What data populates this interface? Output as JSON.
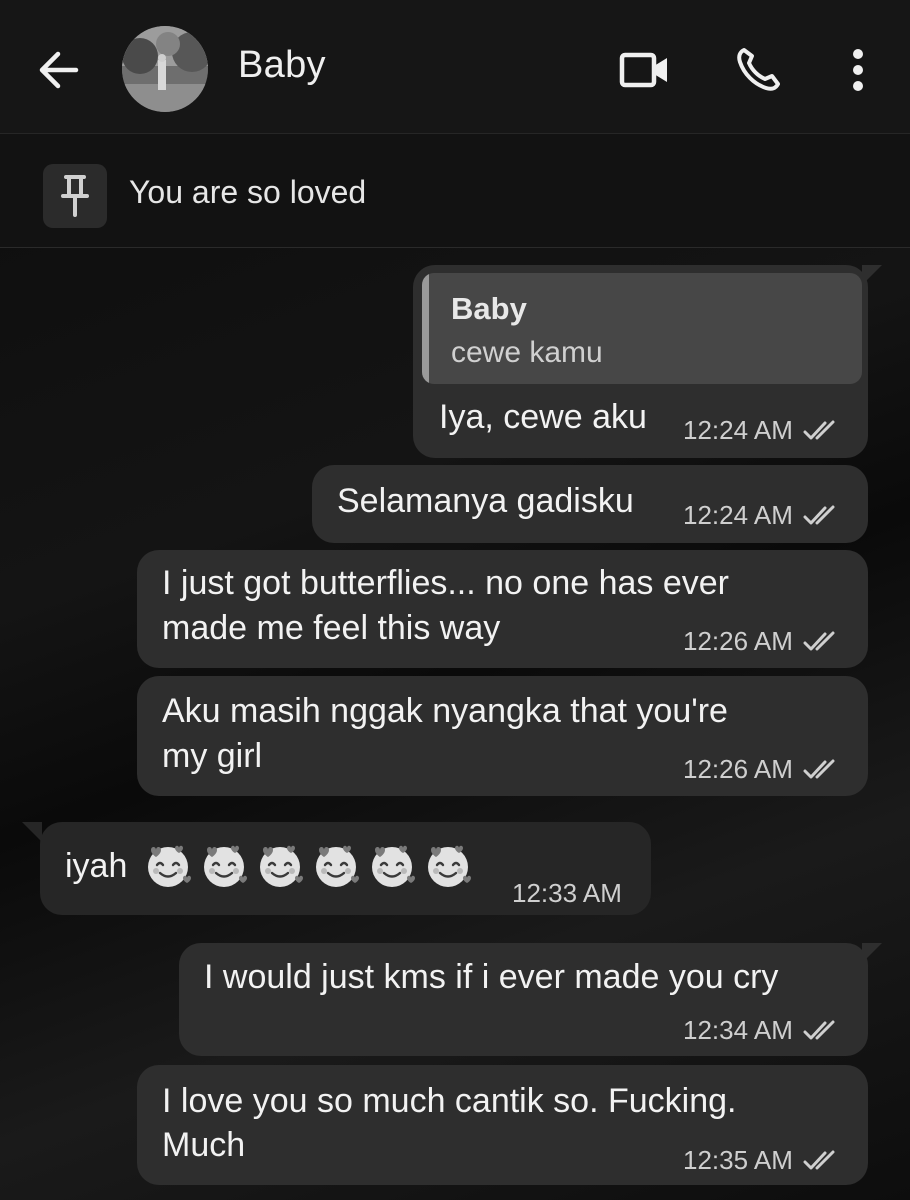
{
  "header": {
    "contact_name": "Baby",
    "icons": [
      "back-arrow-icon",
      "video-call-icon",
      "phone-icon",
      "more-vertical-icon"
    ]
  },
  "pinned": {
    "icon": "pin-icon",
    "text": "You are so loved"
  },
  "messages": [
    {
      "direction": "out",
      "reply_to": {
        "name": "Baby",
        "text": "cewe kamu"
      },
      "lines": [
        "Iya, cewe aku"
      ],
      "time": "12:24 AM",
      "status": "read"
    },
    {
      "direction": "out",
      "lines": [
        "Selamanya gadisku"
      ],
      "time": "12:24 AM",
      "status": "read"
    },
    {
      "direction": "out",
      "lines": [
        "I just got butterflies... no one has ever",
        "made me feel this way"
      ],
      "time": "12:26 AM",
      "status": "read"
    },
    {
      "direction": "out",
      "lines": [
        "Aku masih nggak nyangka that you're",
        "my girl"
      ],
      "time": "12:26 AM",
      "status": "read"
    },
    {
      "direction": "in",
      "lines": [
        "iyah"
      ],
      "emoji": "smiling-face-with-hearts-emoji",
      "emoji_count": 6,
      "time": "12:33 AM"
    },
    {
      "direction": "out",
      "lines": [
        "I would just kms if i ever made you cry"
      ],
      "time": "12:34 AM",
      "status": "read"
    },
    {
      "direction": "out",
      "lines": [
        "I love you so much cantik so. Fucking.",
        "Much"
      ],
      "time": "12:35 AM",
      "status": "read"
    }
  ],
  "colors": {
    "header_bg": "#161616",
    "bubble_out": "#2e2e2e",
    "bubble_in": "#262626",
    "quote_bg": "#474747"
  }
}
